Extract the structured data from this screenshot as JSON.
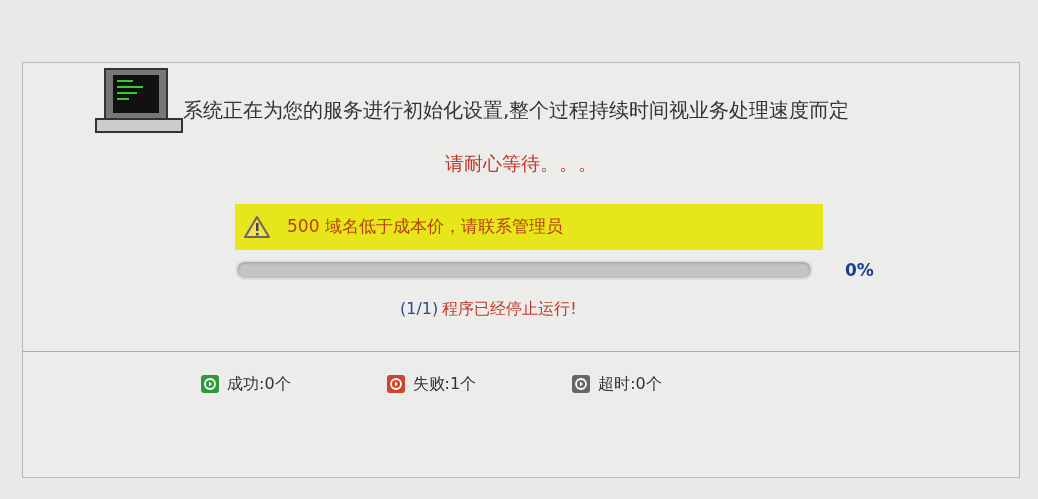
{
  "header": {
    "message": "系统正在为您的服务进行初始化设置,整个过程持续时间视业务处理速度而定",
    "wait_text": "请耐心等待。。。"
  },
  "alert": {
    "text": "500 域名低于成本价，请联系管理员"
  },
  "progress": {
    "level": 0,
    "percent": "0%",
    "counter": "(1/1)",
    "status": "程序已经停止运行!"
  },
  "stats": [
    {
      "label": "成功:0个",
      "color": "#2e9a3a"
    },
    {
      "label": "失败:1个",
      "color": "#d0432c"
    },
    {
      "label": "超时:0个",
      "color": "#666666"
    }
  ]
}
